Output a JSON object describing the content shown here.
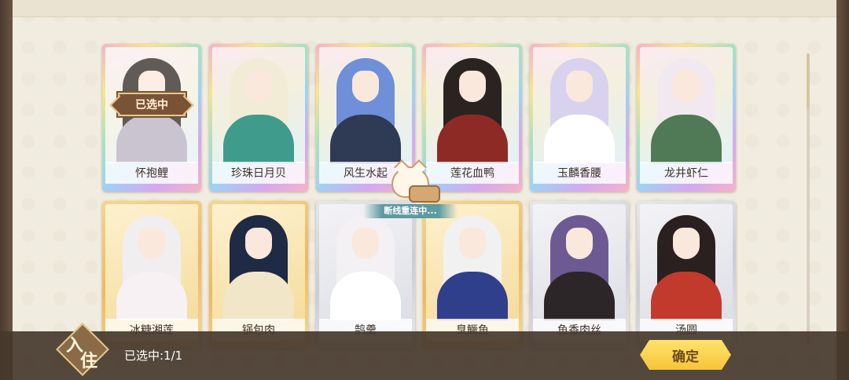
{
  "cards": [
    {
      "name": "怀抱鲤",
      "frame": "rainbow",
      "hair": "#2c2420",
      "outfit": "#b9b0c0",
      "selected": true
    },
    {
      "name": "珍珠日月贝",
      "frame": "rainbow",
      "hair": "#f2ecd6",
      "outfit": "#3f9c8d",
      "selected": false
    },
    {
      "name": "风生水起",
      "frame": "rainbow",
      "hair": "#6f8fd8",
      "outfit": "#2f3a55",
      "selected": false
    },
    {
      "name": "莲花血鸭",
      "frame": "rainbow",
      "hair": "#2b2320",
      "outfit": "#8d2a25",
      "selected": false
    },
    {
      "name": "玉麟香腰",
      "frame": "rainbow",
      "hair": "#d9d2ee",
      "outfit": "#ffffff",
      "selected": false
    },
    {
      "name": "龙井虾仁",
      "frame": "rainbow",
      "hair": "#f2e8ef",
      "outfit": "#4f7a55",
      "selected": false
    },
    {
      "name": "冰糖湘莲",
      "frame": "gold",
      "hair": "#f1eef0",
      "outfit": "#f7f1f4",
      "selected": false
    },
    {
      "name": "锅包肉",
      "frame": "gold",
      "hair": "#1f2a45",
      "outfit": "#f2e6c8",
      "selected": false
    },
    {
      "name": "鹄羹",
      "frame": "silver",
      "hair": "#f3f1f4",
      "outfit": "#ffffff",
      "selected": false
    },
    {
      "name": "臭鳜鱼",
      "frame": "gold",
      "hair": "#f1f1f1",
      "outfit": "#2f3f8c",
      "selected": false
    },
    {
      "name": "鱼香肉丝",
      "frame": "silver",
      "hair": "#6d5a93",
      "outfit": "#2c2628",
      "selected": false
    },
    {
      "name": "汤圆",
      "frame": "silver",
      "hair": "#2b2020",
      "outfit": "#c23a2c",
      "selected": false
    }
  ],
  "selected_badge": "已选中",
  "reconnect_text": "断线重连中...",
  "checkin_label": [
    "入",
    "住"
  ],
  "selected_count": "已选中:1/1",
  "confirm_label": "确定"
}
